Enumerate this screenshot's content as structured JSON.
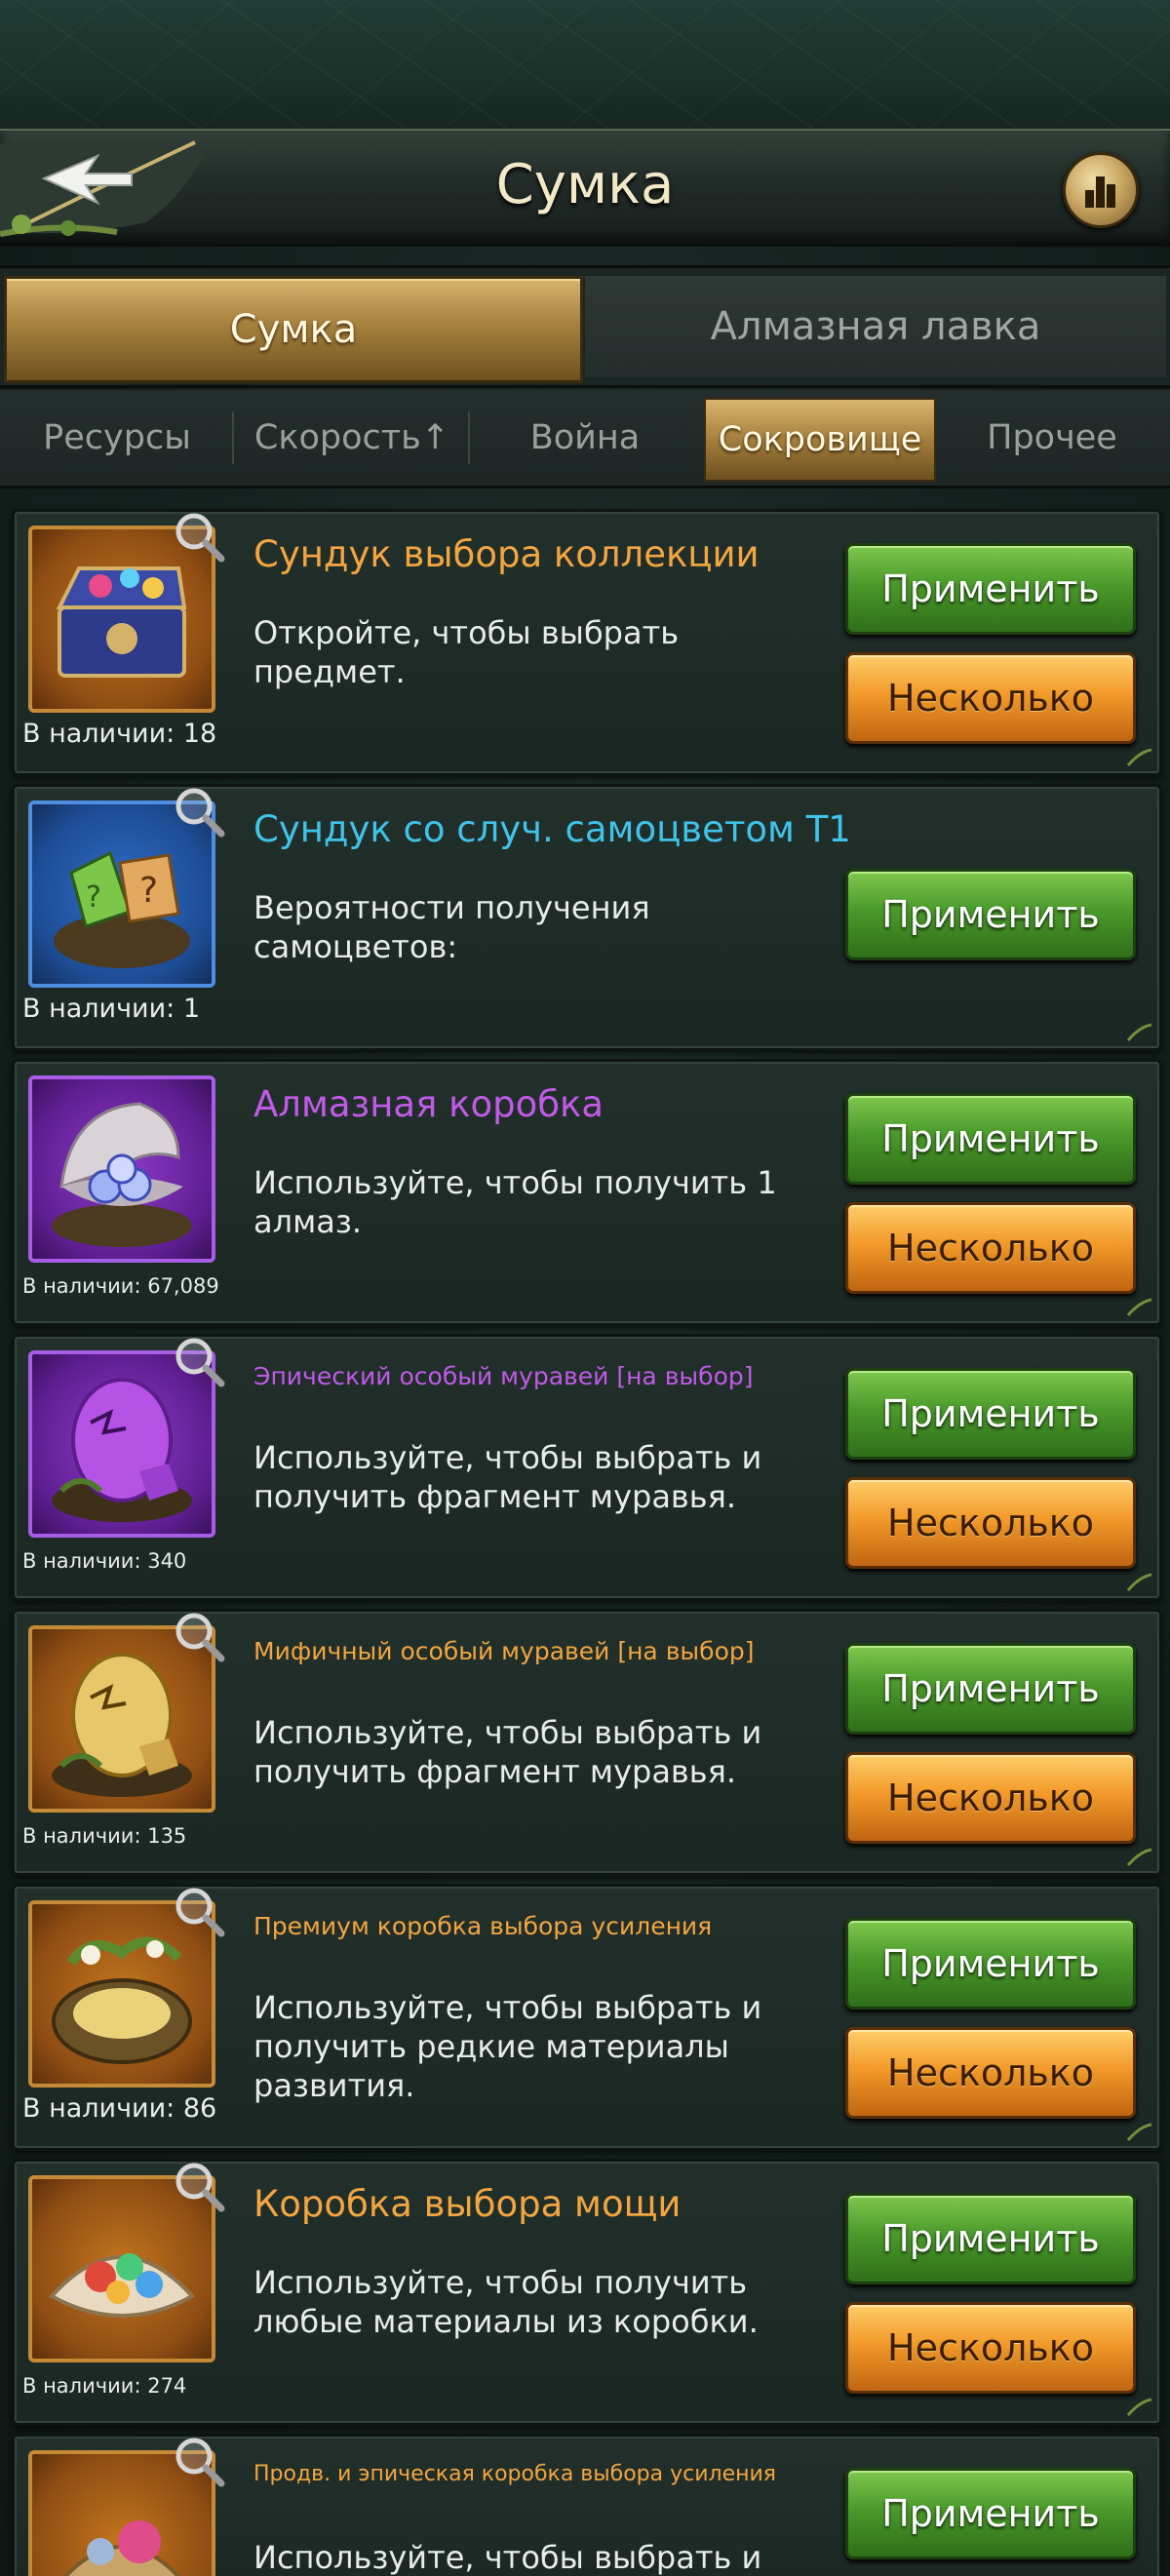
{
  "header": {
    "title": "Сумка",
    "back_icon": "arrow-left-icon",
    "rank_icon": "leaderboard-icon"
  },
  "main_tabs": [
    {
      "label": "Сумка",
      "active": true
    },
    {
      "label": "Алмазная лавка",
      "active": false
    }
  ],
  "sub_tabs": [
    {
      "label": "Ресурсы",
      "active": false
    },
    {
      "label": "Скорость↑",
      "active": false
    },
    {
      "label": "Война",
      "active": false
    },
    {
      "label": "Сокровище",
      "active": true
    },
    {
      "label": "Прочее",
      "active": false
    }
  ],
  "items": [
    {
      "name": "Сундук выбора коллекции",
      "description": "Откройте, чтобы выбрать предмет.",
      "count": "В наличии: 18",
      "apply_label": "Применить",
      "multi_label": "Несколько"
    },
    {
      "name": "Сундук со случ. самоцветом T1",
      "description": "Вероятности получения самоцветов:",
      "count": "В наличии: 1",
      "apply_label": "Применить"
    },
    {
      "name": "Алмазная коробка",
      "description": "Используйте, чтобы получить 1 алмаз.",
      "count": "В наличии: 67,089",
      "apply_label": "Применить",
      "multi_label": "Несколько"
    },
    {
      "name": "Эпический особый муравей [на выбор]",
      "description": "Используйте, чтобы выбрать и получить фрагмент муравья.",
      "count": "В наличии: 340",
      "apply_label": "Применить",
      "multi_label": "Несколько"
    },
    {
      "name": "Мифичный особый муравей [на выбор]",
      "description": "Используйте, чтобы выбрать и получить фрагмент муравья.",
      "count": "В наличии: 135",
      "apply_label": "Применить",
      "multi_label": "Несколько"
    },
    {
      "name": "Премиум коробка выбора усиления",
      "description": "Используйте, чтобы выбрать и получить редкие материалы развития.",
      "count": "В наличии: 86",
      "apply_label": "Применить",
      "multi_label": "Несколько"
    },
    {
      "name": "Коробка выбора мощи",
      "description": "Используйте, чтобы получить любые материалы из коробки.",
      "count": "В наличии: 274",
      "apply_label": "Применить",
      "multi_label": "Несколько"
    },
    {
      "name": "Продв. и эпическая коробка выбора усиления",
      "description": "Используйте, чтобы выбрать и",
      "apply_label": "Применить"
    }
  ],
  "colors": {
    "accent_gold": "#c9a763",
    "btn_green": "#4a9a2b",
    "btn_orange": "#f29a2a",
    "name_orange": "#f3a540",
    "name_blue": "#3fc3ea",
    "name_purple": "#c15ae8"
  }
}
